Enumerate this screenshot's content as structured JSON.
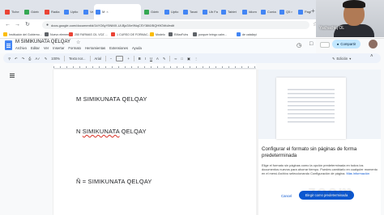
{
  "browser": {
    "tabs": [
      {
        "label": "Tiche",
        "color": "#ea4335",
        "active": false
      },
      {
        "label": "Gdeb",
        "color": "#34a853",
        "active": false
      },
      {
        "label": "Radia",
        "color": "#ea4335",
        "active": false
      },
      {
        "label": "Uptio",
        "color": "#4285f4",
        "active": false
      },
      {
        "label": "Ve",
        "color": "#4285f4",
        "active": false
      },
      {
        "label": "M",
        "color": "#4285f4",
        "active": true
      },
      {
        "label": "Gdeb",
        "color": "#34a853",
        "active": false
      },
      {
        "label": "Uptio",
        "color": "#4285f4",
        "active": false
      },
      {
        "label": "Taxat",
        "color": "#4285f4",
        "active": false
      },
      {
        "label": "Ub Fa",
        "color": "#4285f4",
        "active": false
      },
      {
        "label": "Tablet",
        "color": "#4285f4",
        "active": false
      },
      {
        "label": "Idiom",
        "color": "#4285f4",
        "active": false
      },
      {
        "label": "Conta",
        "color": "#4285f4",
        "active": false
      },
      {
        "label": "Q5 r",
        "color": "#4285f4",
        "active": false
      },
      {
        "label": "Pagin",
        "color": "#4285f4",
        "active": false
      }
    ],
    "url": "docs.google.com/document/d/1kYO6yY5NMX-Ul-Bjz3Xe9NqCSY38t1f5QH9OWd/edit",
    "bookmarks": [
      {
        "label": "Institución del Gobierno...",
        "color": "#fbbc04"
      },
      {
        "label": "Nuevo elemento",
        "color": "#5f6368"
      },
      {
        "label": "250 FARMAS CIL VOZ ...",
        "color": "#ea4335"
      },
      {
        "label": "1 CURSO DE FORMAC...",
        "color": "#ea4335"
      },
      {
        "label": "Modelo",
        "color": "#fbbc04"
      },
      {
        "label": "EMaxFuhs",
        "color": "#5f6368"
      },
      {
        "label": "porquer bringo calm...",
        "color": "#5f6368"
      },
      {
        "label": "de catalizyi",
        "color": "#4285f4"
      }
    ]
  },
  "doc": {
    "title": "M SIMIKUNATA QELQAY",
    "menus": [
      "Archivo",
      "Editar",
      "Ver",
      "Insertar",
      "Formato",
      "Herramientas",
      "Extensiones",
      "Ayuda"
    ],
    "share_label": "Compartir",
    "toolbar": {
      "zoom": "100%",
      "style": "Texto nor...",
      "font": "Arial",
      "editing_mode": "Edición"
    },
    "lines": [
      {
        "prefix": "",
        "underlined": "",
        "suffix": "M SIMIKUNATA QELQAY"
      },
      {
        "prefix": "N ",
        "underlined": "SIMIKUNATA",
        "suffix": " QELQAY"
      },
      {
        "prefix": "",
        "underlined": "",
        "suffix": "Ñ = SIMIKUNATA QELQAY"
      }
    ]
  },
  "webcam": {
    "name": "Yachachiq OL"
  },
  "panel": {
    "title": "Configurar el formato sin páginas de forma predeterminada",
    "body_intro": "Elige el formato sin páginas como la opción predeterminada en todos los documentos nuevos para ahorrar tiempo. Puedes cambiarlo en cualquier momento en el menú Archivo seleccionando Configuración de página.",
    "more_info": "Más información",
    "cancel_label": "Cancel",
    "set_default_label": "Elegir como predeterminada"
  },
  "watermark": "zoom",
  "colors": {
    "accent": "#0b57d0",
    "share_bg": "#c2e7ff",
    "toolbar_bg": "#edf2fa"
  }
}
